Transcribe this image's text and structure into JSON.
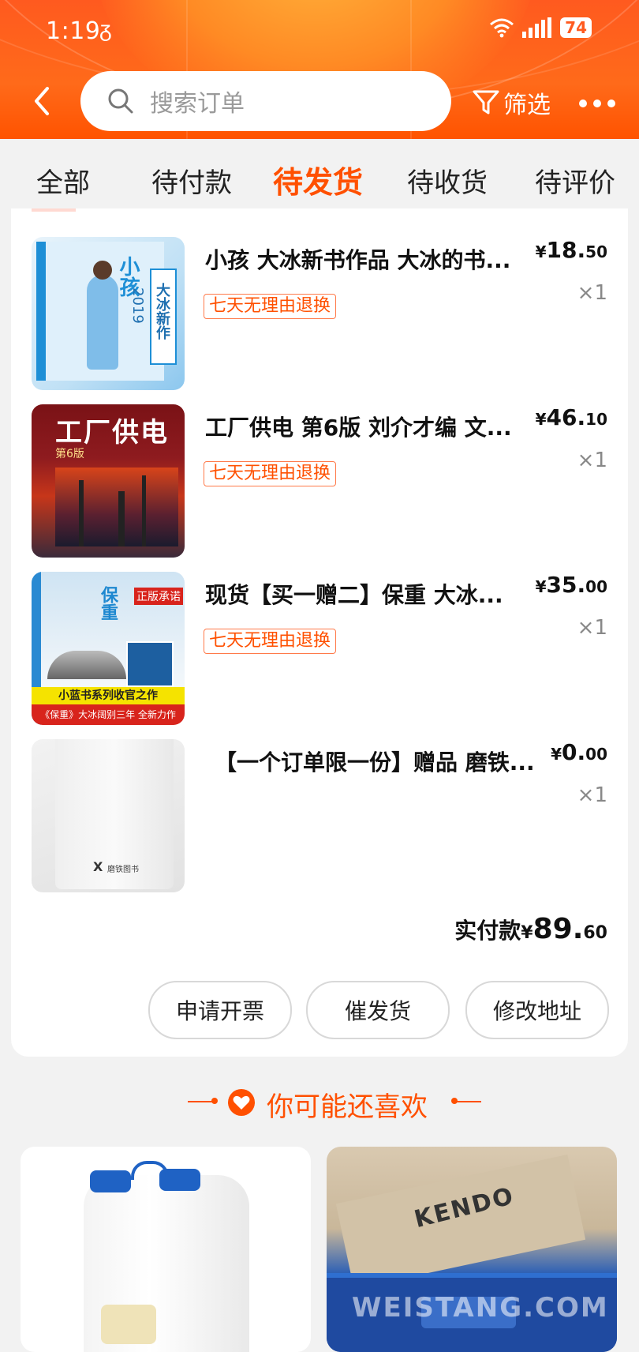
{
  "status": {
    "time": "1:19",
    "carrier": "ᵹ",
    "battery": "74"
  },
  "search": {
    "placeholder": "搜索订单"
  },
  "header": {
    "filter_label": "筛选"
  },
  "tabs": [
    {
      "label": "全部"
    },
    {
      "label": "待付款"
    },
    {
      "label": "待发货"
    },
    {
      "label": "待收货"
    },
    {
      "label": "待评价"
    }
  ],
  "active_tab": "待发货",
  "order": {
    "items": [
      {
        "title": "小孩 大冰新书作品 大冰的书...",
        "tag": "七天无理由退换",
        "currency": "¥",
        "price_int": "18.",
        "price_dec": "50",
        "qty": "×1",
        "cover": {
          "main_text": "小孩",
          "side_text": "大冰新作",
          "year": "2019"
        }
      },
      {
        "title": "工厂供电 第6版 刘介才编 文...",
        "tag": "七天无理由退换",
        "currency": "¥",
        "price_int": "46.",
        "price_dec": "10",
        "qty": "×1",
        "cover": {
          "main_text": "工厂供电",
          "edition": "第6版"
        }
      },
      {
        "title": "现货【买一赠二】保重 大冰...",
        "tag": "七天无理由退换",
        "currency": "¥",
        "price_int": "35.",
        "price_dec": "00",
        "qty": "×1",
        "cover": {
          "main_text": "保重",
          "badge": "正版承诺",
          "banner1": "小蓝书系列收官之作",
          "banner2": "《保重》大冰阔别三年 全新力作"
        }
      },
      {
        "title": "【一个订单限一份】赠品 磨铁...",
        "tag": "",
        "currency": "¥",
        "price_int": "0.",
        "price_dec": "00",
        "qty": "×1",
        "cover": {
          "brand": "磨铁图书"
        }
      }
    ],
    "total_label": "实付款",
    "total_currency": "¥",
    "total_int": "89.",
    "total_dec": "60",
    "buttons": {
      "invoice": "申请开票",
      "urge": "催发货",
      "address": "修改地址"
    }
  },
  "recommend": {
    "title": "你可能还喜欢",
    "card2_text": "KENDO"
  },
  "watermark": "WEISTANG.COM",
  "colors": {
    "accent": "#ff5000",
    "header": "#ff6a1a",
    "background": "#f2f2f2"
  }
}
